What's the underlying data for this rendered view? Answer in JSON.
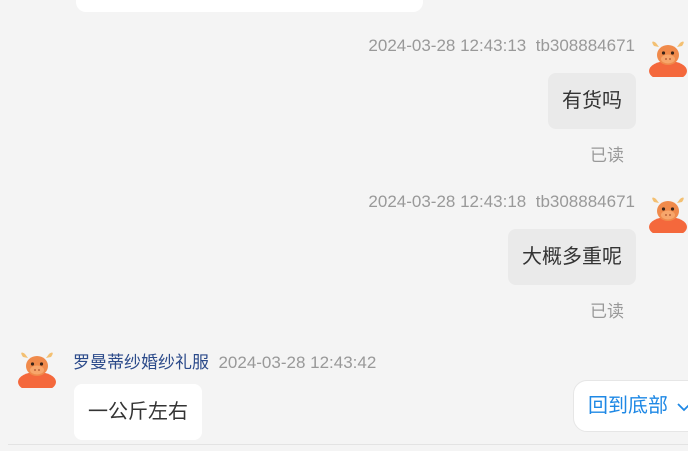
{
  "messages": [
    {
      "timestamp": "2024-03-28 12:43:13",
      "sender": "tb308884671",
      "text": "有货吗",
      "status": "已读"
    },
    {
      "timestamp": "2024-03-28 12:43:18",
      "sender": "tb308884671",
      "text": "大概多重呢",
      "status": "已读"
    },
    {
      "sender": "罗曼蒂纱婚纱礼服",
      "timestamp": "2024-03-28 12:43:42",
      "text": "一公斤左右"
    }
  ],
  "jump_to_bottom": {
    "label": "回到底部",
    "icon": "chevron-down-icon"
  },
  "colors": {
    "background": "#f4f4f4",
    "outgoing_bubble": "#eaeaea",
    "incoming_bubble": "#ffffff",
    "seller_name": "#2b4a8a",
    "accent": "#1e88e5"
  }
}
